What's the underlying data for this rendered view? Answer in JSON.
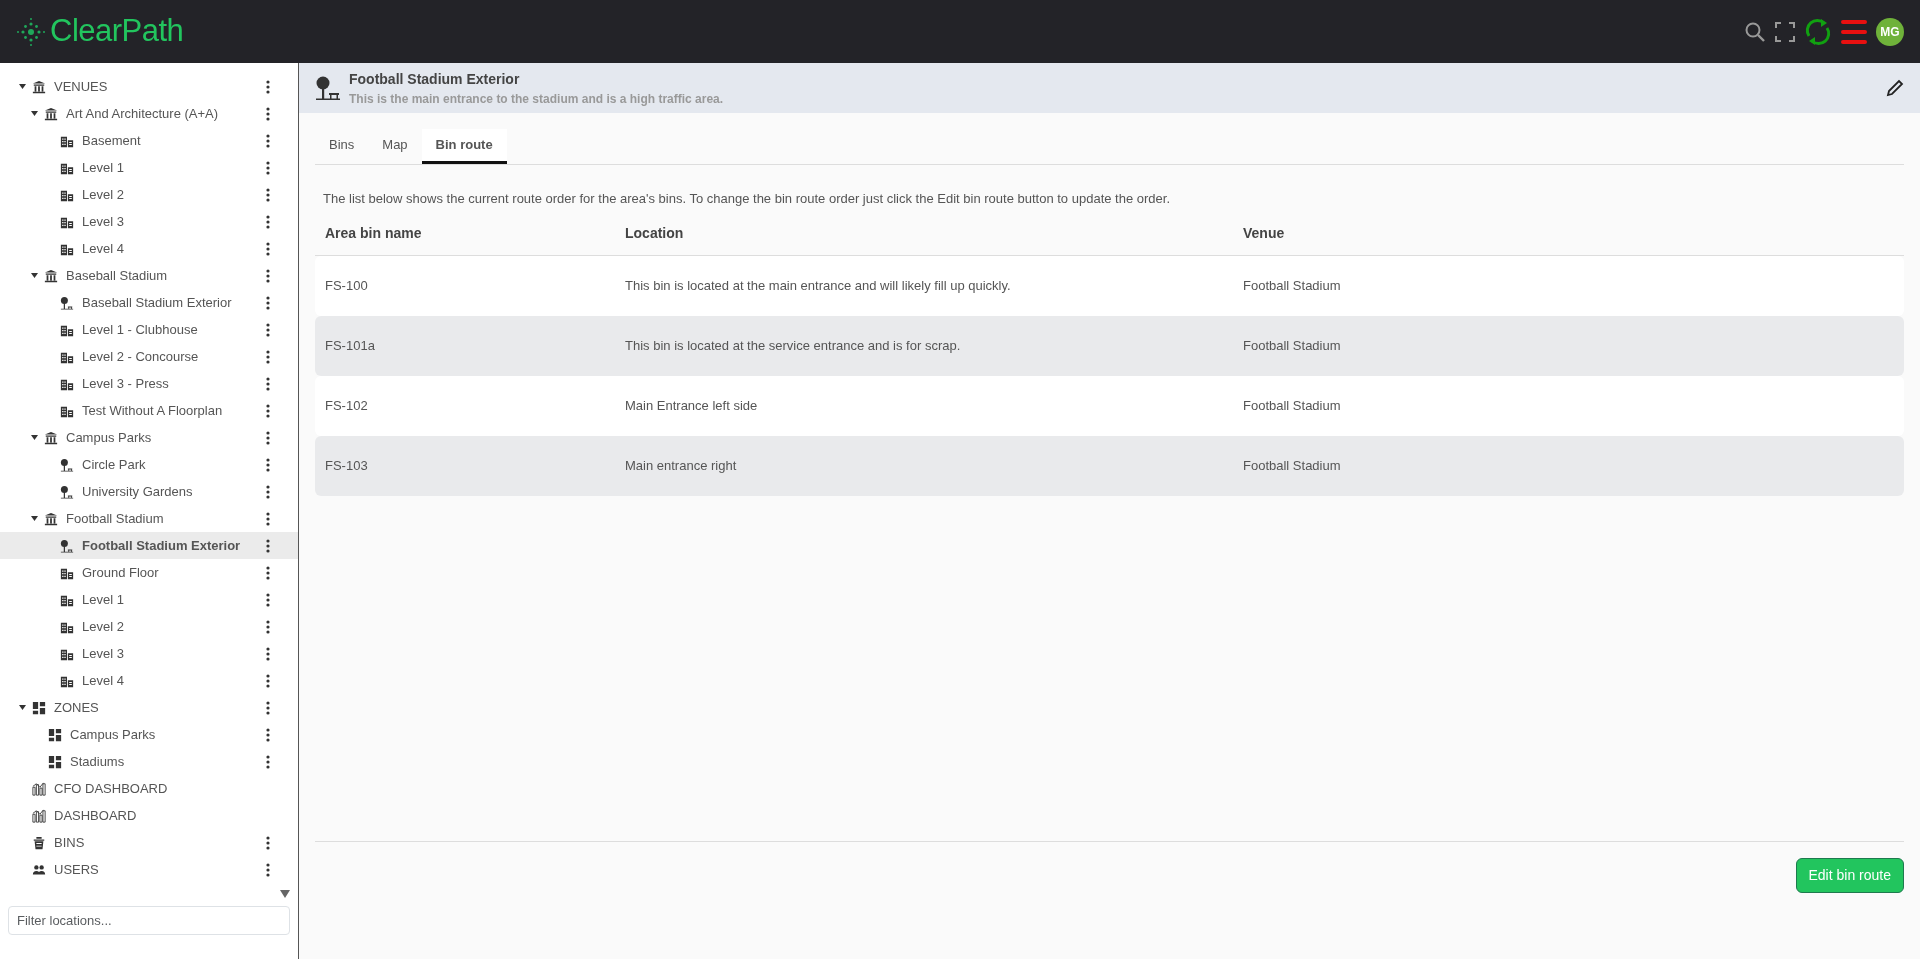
{
  "app": {
    "logo": "ClearPath",
    "avatar": "MG"
  },
  "sidebar": {
    "tree": [
      {
        "label": "VENUES",
        "kind": "venue",
        "expanded": true,
        "selected": false,
        "menu": true,
        "children": [
          {
            "label": "Art And Architecture (A+A)",
            "kind": "venue",
            "expanded": true,
            "selected": false,
            "menu": true,
            "children": [
              {
                "label": "Basement",
                "kind": "floor",
                "selected": false,
                "menu": true
              },
              {
                "label": "Level 1",
                "kind": "floor",
                "selected": false,
                "menu": true
              },
              {
                "label": "Level 2",
                "kind": "floor",
                "selected": false,
                "menu": true
              },
              {
                "label": "Level 3",
                "kind": "floor",
                "selected": false,
                "menu": true
              },
              {
                "label": "Level 4",
                "kind": "floor",
                "selected": false,
                "menu": true
              }
            ]
          },
          {
            "label": "Baseball Stadium",
            "kind": "venue",
            "expanded": true,
            "selected": false,
            "menu": true,
            "children": [
              {
                "label": "Baseball Stadium Exterior",
                "kind": "park",
                "selected": false,
                "menu": true
              },
              {
                "label": "Level 1 - Clubhouse",
                "kind": "floor",
                "selected": false,
                "menu": true
              },
              {
                "label": "Level 2 - Concourse",
                "kind": "floor",
                "selected": false,
                "menu": true
              },
              {
                "label": "Level 3 - Press",
                "kind": "floor",
                "selected": false,
                "menu": true
              },
              {
                "label": "Test Without A Floorplan",
                "kind": "floor",
                "selected": false,
                "menu": true
              }
            ]
          },
          {
            "label": "Campus Parks",
            "kind": "venue",
            "expanded": true,
            "selected": false,
            "menu": true,
            "children": [
              {
                "label": "Circle Park",
                "kind": "park",
                "selected": false,
                "menu": true
              },
              {
                "label": "University Gardens",
                "kind": "park",
                "selected": false,
                "menu": true
              }
            ]
          },
          {
            "label": "Football Stadium",
            "kind": "venue",
            "expanded": true,
            "selected": false,
            "menu": true,
            "children": [
              {
                "label": "Football Stadium Exterior",
                "kind": "park",
                "selected": true,
                "menu": true
              },
              {
                "label": "Ground Floor",
                "kind": "floor",
                "selected": false,
                "menu": true
              },
              {
                "label": "Level 1",
                "kind": "floor",
                "selected": false,
                "menu": true
              },
              {
                "label": "Level 2",
                "kind": "floor",
                "selected": false,
                "menu": true
              },
              {
                "label": "Level 3",
                "kind": "floor",
                "selected": false,
                "menu": true
              },
              {
                "label": "Level 4",
                "kind": "floor",
                "selected": false,
                "menu": true
              }
            ]
          }
        ]
      },
      {
        "label": "ZONES",
        "kind": "zone",
        "expanded": true,
        "selected": false,
        "menu": true,
        "children": [
          {
            "label": "Campus Parks",
            "kind": "zone",
            "selected": false,
            "menu": true
          },
          {
            "label": "Stadiums",
            "kind": "zone",
            "selected": false,
            "menu": true
          }
        ]
      },
      {
        "label": "CFO DASHBOARD",
        "kind": "dashboard",
        "selected": false,
        "menu": false
      },
      {
        "label": "DASHBOARD",
        "kind": "dashboard",
        "selected": false,
        "menu": false
      },
      {
        "label": "BINS",
        "kind": "bins",
        "selected": false,
        "menu": true
      },
      {
        "label": "USERS",
        "kind": "users",
        "selected": false,
        "menu": true
      }
    ],
    "filter": {
      "placeholder": "Filter locations..."
    }
  },
  "header": {
    "title": "Football Stadium Exterior",
    "subtitle": "This is the main entrance to the stadium and is a high traffic area."
  },
  "tabs": [
    {
      "label": "Bins",
      "selected": false
    },
    {
      "label": "Map",
      "selected": false
    },
    {
      "label": "Bin route",
      "selected": true
    }
  ],
  "description": "The list below shows the current route order for the area's bins. To change the bin route order just click the Edit bin route button to update the order.",
  "table": {
    "columns": [
      "Area bin name",
      "Location",
      "Venue"
    ],
    "rows": [
      [
        "FS-100",
        "This bin is located at the main entrance and will likely fill up quickly.",
        "Football Stadium"
      ],
      [
        "FS-101a",
        "This bin is located at the service entrance and is for scrap.",
        "Football Stadium"
      ],
      [
        "FS-102",
        "Main Entrance left side",
        "Football Stadium"
      ],
      [
        "FS-103",
        "Main entrance right",
        "Football Stadium"
      ]
    ]
  },
  "edit_button": "Edit bin route"
}
